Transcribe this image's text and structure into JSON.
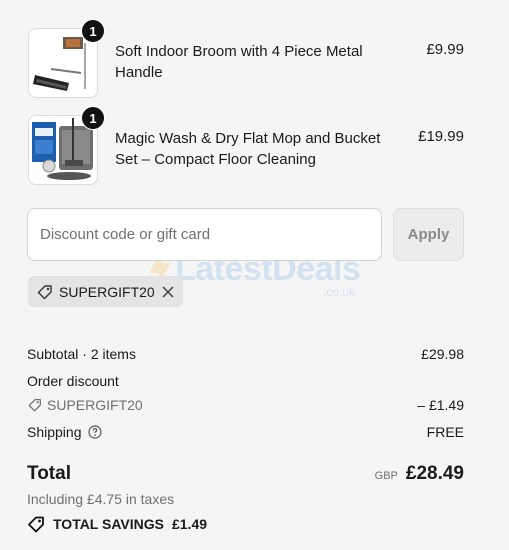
{
  "items": [
    {
      "name": "Soft Indoor Broom with 4 Piece Metal Handle",
      "price": "£9.99",
      "quantity": "1",
      "image_icon": "broom-icon"
    },
    {
      "name": "Magic Wash & Dry Flat Mop and Bucket Set – Compact Floor Cleaning",
      "price": "£19.99",
      "quantity": "1",
      "image_icon": "mop-bucket-icon"
    }
  ],
  "discount": {
    "placeholder": "Discount code or gift card",
    "value": "",
    "apply_label": "Apply",
    "applied_code": "SUPERGIFT20"
  },
  "watermark": {
    "text": "LatestDeals",
    "subtext": ".co.uk"
  },
  "summary": {
    "subtotal_label": "Subtotal · 2 items",
    "subtotal_value": "£29.98",
    "order_discount_label": "Order discount",
    "order_discount_code": "SUPERGIFT20",
    "order_discount_value": "– £1.49",
    "shipping_label": "Shipping",
    "shipping_value": "FREE",
    "total_label": "Total",
    "currency": "GBP",
    "total_value": "£28.49",
    "taxes_note": "Including £4.75 in taxes",
    "savings_label": "TOTAL SAVINGS",
    "savings_value": "£1.49"
  },
  "colors": {
    "background": "#f5f5f5",
    "badge": "#111111",
    "muted_text": "#707070"
  }
}
